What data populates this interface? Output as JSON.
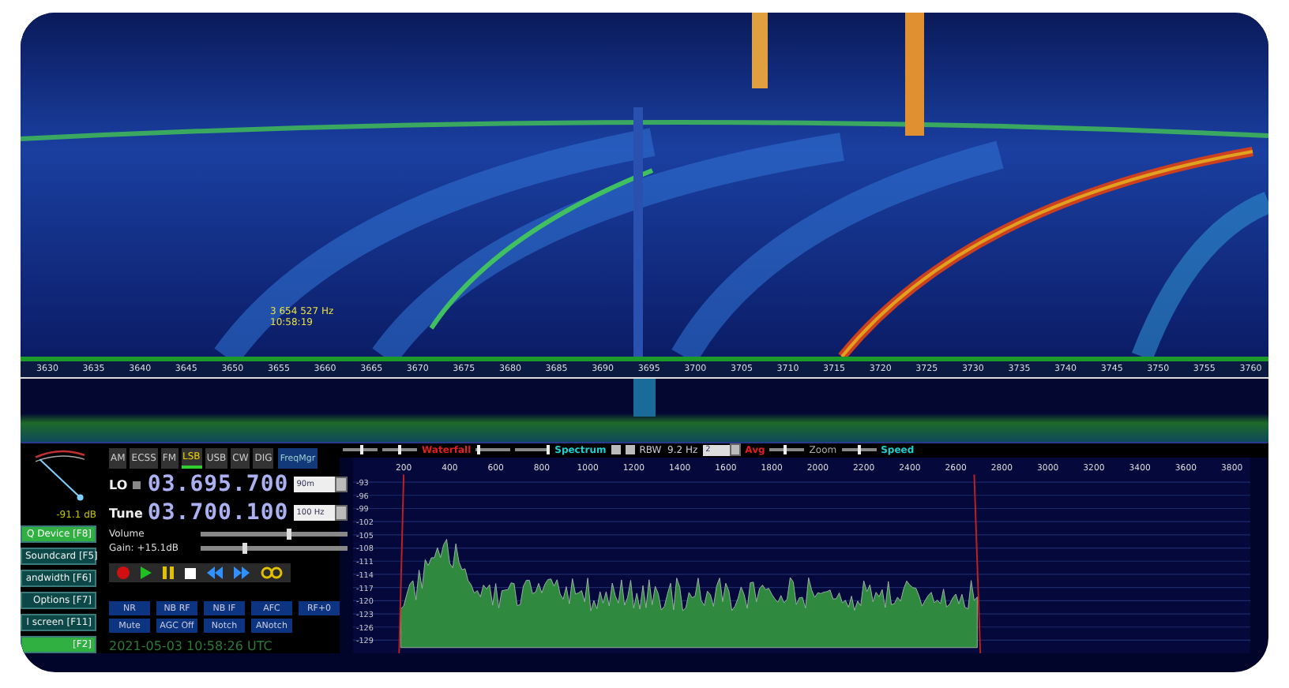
{
  "waterfall": {
    "marker_frequency": "3 654 527 Hz",
    "marker_time": "10:58:19",
    "axis_labels": [
      "3630",
      "3635",
      "3640",
      "3645",
      "3650",
      "3655",
      "3660",
      "3665",
      "3670",
      "3675",
      "3680",
      "3685",
      "3690",
      "3695",
      "3700",
      "3705",
      "3710",
      "3715",
      "3720",
      "3725",
      "3730",
      "3735",
      "3740",
      "3745",
      "3750",
      "3755",
      "3760"
    ]
  },
  "s_meter": {
    "reading": "-91.1 dB"
  },
  "side_buttons": [
    {
      "label": "Q Device [F8]",
      "active": true
    },
    {
      "label": "Soundcard [F5]",
      "active": false
    },
    {
      "label": "andwidth [F6]",
      "active": false
    },
    {
      "label": "Options [F7]",
      "active": false
    },
    {
      "label": "l screen [F11]",
      "active": false
    },
    {
      "label": "[F2]",
      "active": true
    }
  ],
  "mode_buttons": [
    {
      "label": "AM",
      "selected": false
    },
    {
      "label": "ECSS",
      "selected": false
    },
    {
      "label": "FM",
      "selected": false
    },
    {
      "label": "LSB",
      "selected": true
    },
    {
      "label": "USB",
      "selected": false
    },
    {
      "label": "CW",
      "selected": false
    },
    {
      "label": "DIG",
      "selected": false
    }
  ],
  "freq_mgr_button": "FreqMgr",
  "lo": {
    "label": "LO",
    "value": "03.695.700",
    "band": "90m"
  },
  "tune": {
    "label": "Tune",
    "value": "03.700.100",
    "step": "100 Hz"
  },
  "volume": {
    "label": "Volume",
    "level": 0.6
  },
  "gain": {
    "label": "Gain: +15.1dB",
    "level": 0.3
  },
  "dsp_buttons": [
    {
      "label": "NR"
    },
    {
      "label": "NB RF"
    },
    {
      "label": "NB IF"
    },
    {
      "label": "AFC"
    },
    {
      "label": "RF+0"
    },
    {
      "label": "Mute"
    },
    {
      "label": "AGC Off"
    },
    {
      "label": "Notch"
    },
    {
      "label": "ANotch"
    }
  ],
  "clock": "2021-05-03 10:58:26 UTC",
  "spectrum": {
    "waterfall_label": "Waterfall",
    "spectrum_label": "Spectrum",
    "rbw": "RBW  9.2 Hz",
    "avg_value": "2",
    "avg_label": "Avg",
    "zoom_label": "Zoom",
    "speed_label": "Speed",
    "waterfall_sliders": [
      {
        "level": 0.55
      },
      {
        "level": 0.5
      }
    ],
    "spectrum_sliders": [
      {
        "level": 0.1
      },
      {
        "level": 0.95
      }
    ],
    "zoom_slider": {
      "level": 0.45
    },
    "speed_slider": {
      "level": 0.5
    },
    "x_labels": [
      "200",
      "400",
      "600",
      "800",
      "1000",
      "1200",
      "1400",
      "1600",
      "1800",
      "2000",
      "2200",
      "2400",
      "2600",
      "2800",
      "3000",
      "3200",
      "3400",
      "3600",
      "3800"
    ],
    "y_labels": [
      "-93",
      "-96",
      "-99",
      "-102",
      "-105",
      "-108",
      "-111",
      "-114",
      "-117",
      "-120",
      "-123",
      "-126",
      "-129"
    ]
  }
}
